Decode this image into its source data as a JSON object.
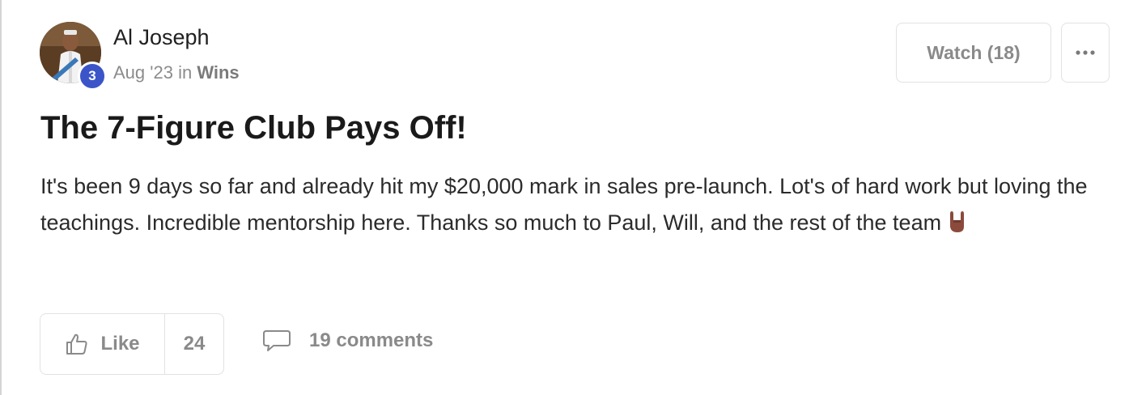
{
  "author": {
    "name": "Al Joseph",
    "level": "3"
  },
  "meta": {
    "date": "Aug '23",
    "in_word": "in",
    "category": "Wins"
  },
  "actions": {
    "watch_label": "Watch (18)",
    "more_icon": "ellipsis-icon"
  },
  "post": {
    "title": "The 7-Figure Club Pays Off!",
    "body": "It's been 9 days so far and already hit my $20,000 mark in sales pre-launch. Lot's of hard work but loving the teachings. Incredible mentorship here. Thanks so much to Paul, Will, and the rest of the team",
    "body_emoji": "rock-on-hand-emoji"
  },
  "footer": {
    "like_label": "Like",
    "like_count": "24",
    "comments_label": "19 comments",
    "like_icon": "thumbs-up-icon",
    "comments_icon": "comment-bubble-icon"
  },
  "colors": {
    "level_badge": "#3b55c9",
    "muted_text": "#8a8a8a",
    "border": "#e2e2e2"
  }
}
